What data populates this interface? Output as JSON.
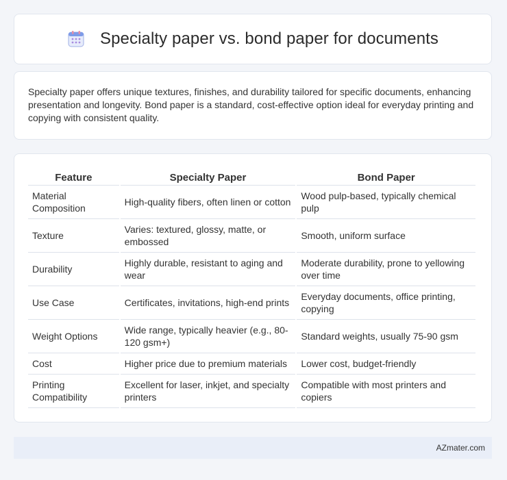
{
  "header": {
    "icon": "calendar-icon",
    "title": "Specialty paper vs. bond paper for documents"
  },
  "intro": {
    "text": "Specialty paper offers unique textures, finishes, and durability tailored for specific documents, enhancing presentation and longevity. Bond paper is a standard, cost-effective option ideal for everyday printing and copying with consistent quality."
  },
  "table": {
    "headers": [
      "Feature",
      "Specialty Paper",
      "Bond Paper"
    ],
    "rows": [
      [
        "Material Composition",
        "High-quality fibers, often linen or cotton",
        "Wood pulp-based, typically chemical pulp"
      ],
      [
        "Texture",
        "Varies: textured, glossy, matte, or embossed",
        "Smooth, uniform surface"
      ],
      [
        "Durability",
        "Highly durable, resistant to aging and wear",
        "Moderate durability, prone to yellowing over time"
      ],
      [
        "Use Case",
        "Certificates, invitations, high-end prints",
        "Everyday documents, office printing, copying"
      ],
      [
        "Weight Options",
        "Wide range, typically heavier (e.g., 80-120 gsm+)",
        "Standard weights, usually 75-90 gsm"
      ],
      [
        "Cost",
        "Higher price due to premium materials",
        "Lower cost, budget-friendly"
      ],
      [
        "Printing Compatibility",
        "Excellent for laser, inkjet, and specialty printers",
        "Compatible with most printers and copiers"
      ]
    ]
  },
  "footer": {
    "brand": "AZmater.com"
  }
}
